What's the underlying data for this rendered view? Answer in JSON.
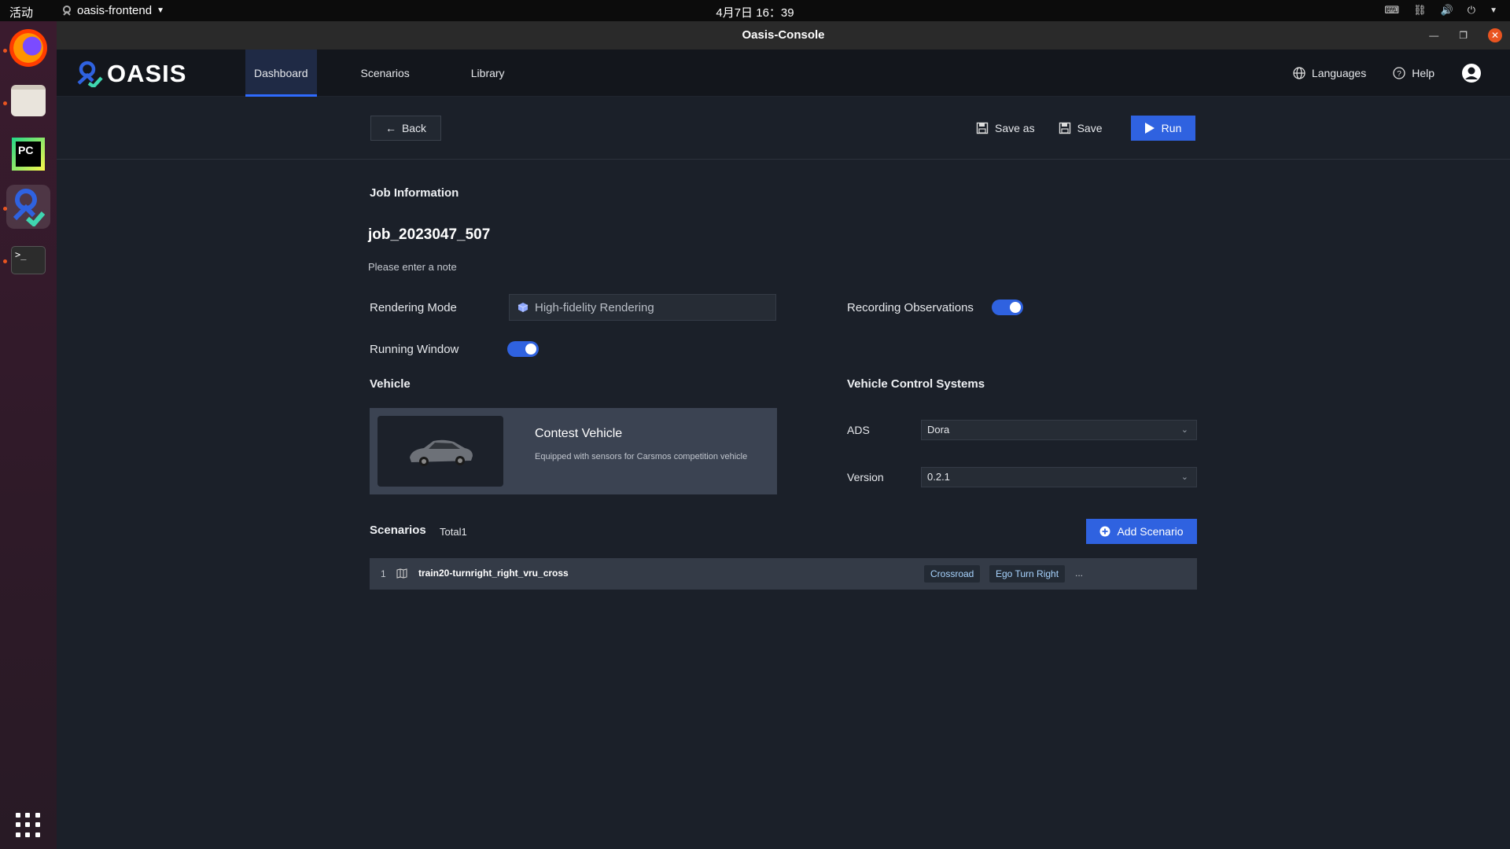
{
  "os": {
    "activities": "活动",
    "app_name": "oasis-frontend",
    "clock": "4月7日 16：39"
  },
  "dock": {
    "items": [
      "firefox-icon",
      "files-icon",
      "pycharm-icon",
      "oasis-icon",
      "terminal-icon"
    ],
    "pycharm_label": "PC",
    "terminal_prompt": ">_"
  },
  "window": {
    "title": "Oasis-Console"
  },
  "header": {
    "logo": "OASIS",
    "nav": [
      {
        "label": "Dashboard",
        "active": true
      },
      {
        "label": "Scenarios",
        "active": false
      },
      {
        "label": "Library",
        "active": false
      }
    ],
    "languages": "Languages",
    "help": "Help"
  },
  "toolbar": {
    "back": "Back",
    "save_as": "Save as",
    "save": "Save",
    "run": "Run"
  },
  "job": {
    "section_title": "Job Information",
    "name": "job_2023047_507",
    "note_placeholder": "Please enter a note",
    "rendering_mode_label": "Rendering Mode",
    "rendering_mode_value": "High-fidelity Rendering",
    "recording_label": "Recording Observations",
    "recording_on": true,
    "running_window_label": "Running Window",
    "running_window_on": true
  },
  "vehicle": {
    "section_title": "Vehicle",
    "name": "Contest Vehicle",
    "description": "Equipped with sensors for Carsmos competition vehicle"
  },
  "control": {
    "section_title": "Vehicle Control Systems",
    "ads_label": "ADS",
    "ads_value": "Dora",
    "version_label": "Version",
    "version_value": "0.2.1"
  },
  "scenarios": {
    "section_title": "Scenarios",
    "total": "Total1",
    "add_button": "Add Scenario",
    "rows": [
      {
        "index": "1",
        "name": "train20-turnright_right_vru_cross",
        "tags": [
          "Crossroad",
          "Ego Turn Right"
        ],
        "more": "..."
      }
    ]
  },
  "colors": {
    "accent": "#2f62e0",
    "background": "#1b2029",
    "header": "#13161c",
    "dock_active_dot": "#e95420"
  }
}
